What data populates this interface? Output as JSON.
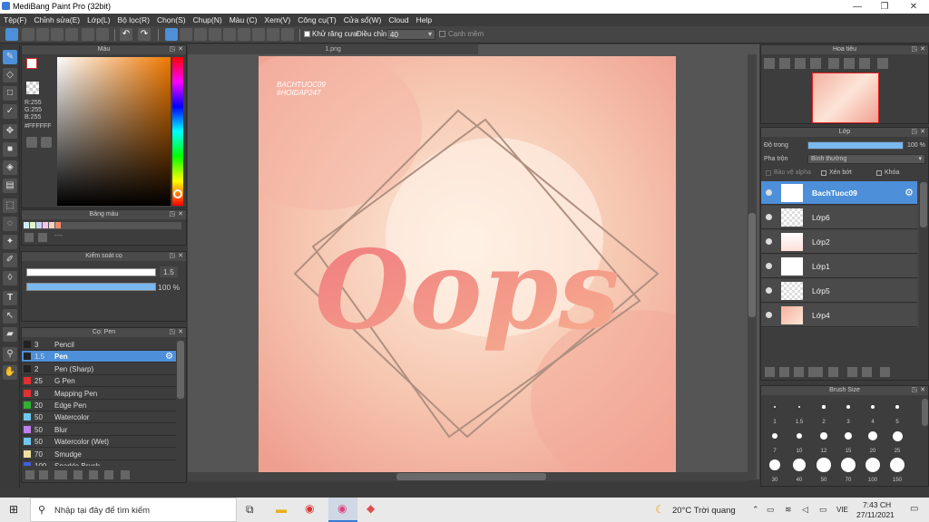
{
  "window": {
    "title": "MediBang Paint Pro (32bit)"
  },
  "menu": [
    "Tệp(F)",
    "Chỉnh sửa(E)",
    "Lớp(L)",
    "Bộ lọc(R)",
    "Chọn(S)",
    "Chụp(N)",
    "Màu (C)",
    "Xem(V)",
    "Công cụ(T)",
    "Cửa sổ(W)",
    "Cloud",
    "Help"
  ],
  "toolbar": {
    "antialias_label": "Khử răng cưa",
    "adjust_label": "Điều chỉnh",
    "adjust_value": "40",
    "smooth_label": "Cạnh mềm"
  },
  "color_panel": {
    "title": "Màu",
    "r": "R:255",
    "g": "G:255",
    "b": "B:255",
    "hex": "#FFFFFF",
    "fg": "#ffffff",
    "bg": "#f08a6a"
  },
  "palette_panel": {
    "title": "Bảng màu",
    "dashes": "----"
  },
  "brush_control": {
    "title": "Kiểm soát cọ",
    "size": "1.5",
    "opacity": "100 %"
  },
  "brush_panel": {
    "title": "Cọ: Pen",
    "items": [
      {
        "size": "3",
        "name": "Pencil",
        "color": "#222222"
      },
      {
        "size": "1.5",
        "name": "Pen",
        "color": "#222222"
      },
      {
        "size": "2",
        "name": "Pen (Sharp)",
        "color": "#222222"
      },
      {
        "size": "25",
        "name": "G Pen",
        "color": "#e03030"
      },
      {
        "size": "8",
        "name": "Mapping Pen",
        "color": "#e03030"
      },
      {
        "size": "20",
        "name": "Edge Pen",
        "color": "#30b030"
      },
      {
        "size": "50",
        "name": "Watercolor",
        "color": "#70c8f0"
      },
      {
        "size": "50",
        "name": "Blur",
        "color": "#c080f0"
      },
      {
        "size": "50",
        "name": "Watercolor (Wet)",
        "color": "#70c8f0"
      },
      {
        "size": "70",
        "name": "Smudge",
        "color": "#f0e0a0"
      },
      {
        "size": "100",
        "name": "Sparkle Brush",
        "color": "#4060e0"
      }
    ]
  },
  "canvas": {
    "tab": "1.png",
    "watermark_1": "BACHTUOC09",
    "watermark_2": "#HOIDAP247",
    "art_text": "Oops"
  },
  "navigator": {
    "title": "Hoa tiêu"
  },
  "layer_panel": {
    "title": "Lớp",
    "opacity_label": "Độ trong",
    "opacity_value": "100 %",
    "blend_label": "Pha trộn",
    "blend_value": "Bình thường",
    "protect_alpha": "Bảo vệ alpha",
    "clip": "Xén bớt",
    "lock": "Khóa",
    "layers": [
      "BachTuoc09",
      "Lớp6",
      "Lớp2",
      "Lớp1",
      "Lớp5",
      "Lớp4"
    ]
  },
  "brush_size_panel": {
    "title": "Brush Size",
    "sizes": [
      "1",
      "1.5",
      "2",
      "3",
      "4",
      "5",
      "7",
      "10",
      "12",
      "15",
      "20",
      "25",
      "30",
      "40",
      "50",
      "70",
      "100",
      "150"
    ]
  },
  "taskbar": {
    "search_placeholder": "Nhập tại đây để tìm kiếm",
    "weather": "20°C Trời quang",
    "lang": "VIE",
    "time": "7:43 CH",
    "date": "27/11/2021"
  }
}
